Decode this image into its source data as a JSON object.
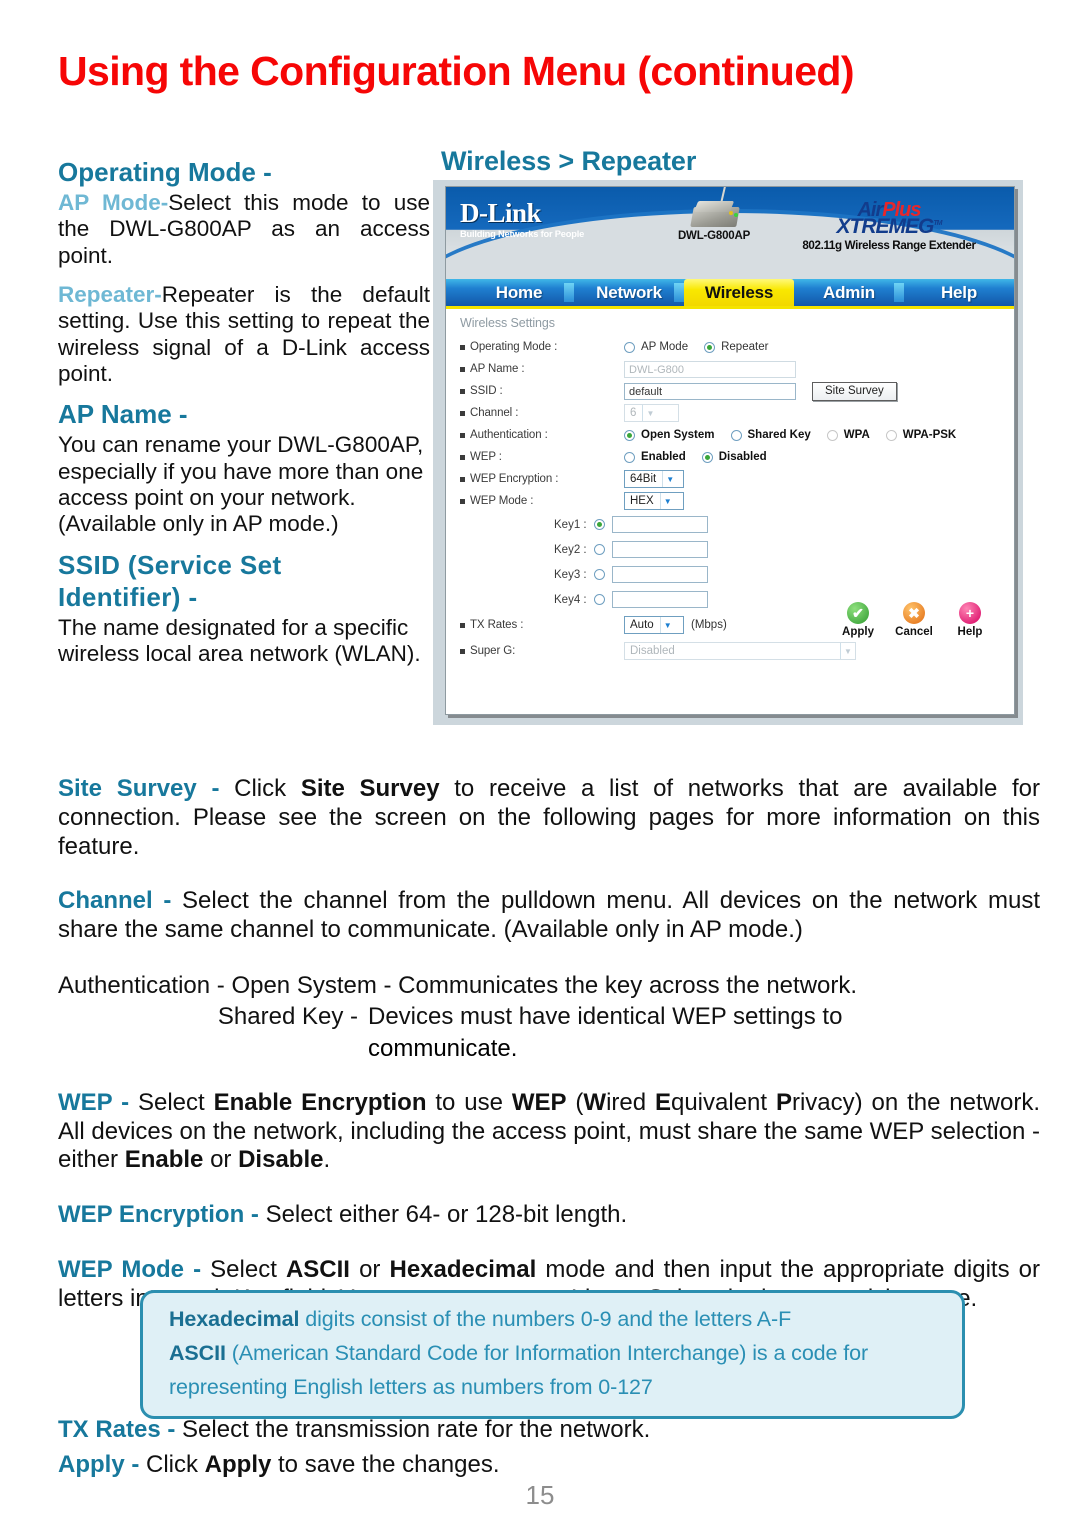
{
  "page": {
    "title": "Using the Configuration Menu (continued)",
    "number": "15",
    "accent_red": "#f60606",
    "accent_blue": "#17789c",
    "accent_light_blue": "#6fb8d4"
  },
  "left_column": {
    "operating_mode": {
      "heading": "Operating Mode -",
      "ap_mode_label": "AP Mode-",
      "ap_mode_text": "Select this mode to use the DWL-G800AP as an access point.",
      "repeater_label": "Repeater-",
      "repeater_text": "Repeater is the default setting. Use this setting to repeat the wireless signal of a D-Link access point."
    },
    "ap_name": {
      "heading": "AP Name -",
      "text": "You can rename your DWL-G800AP, especially if you have more than one access point on your network. (Available only in AP mode.)"
    },
    "ssid": {
      "heading_line1": "SSID (Service Set",
      "heading_line2": "Identifier) -",
      "text": "The name designated for a specific wireless local area network (WLAN)."
    }
  },
  "screenshot": {
    "caption": "Wireless > Repeater",
    "brand": {
      "name": "D-Link",
      "tagline": "Building Networks for People",
      "device_model": "DWL-G800AP",
      "product_air": "Air",
      "product_plus": "Plus",
      "product_xtreme": "XTREME",
      "product_g": "G",
      "product_tm": "TM",
      "product_subtitle": "802.11g Wireless Range Extender"
    },
    "tabs": [
      {
        "label": "Home",
        "active": false
      },
      {
        "label": "Network",
        "active": false
      },
      {
        "label": "Wireless",
        "active": true
      },
      {
        "label": "Admin",
        "active": false
      },
      {
        "label": "Help",
        "active": false
      }
    ],
    "section_title": "Wireless Settings",
    "fields": {
      "operating_mode_label": "Operating Mode :",
      "operating_mode_opt1": "AP Mode",
      "operating_mode_opt2": "Repeater",
      "operating_mode_selected": "Repeater",
      "ap_name_label": "AP Name :",
      "ap_name_value": "DWL-G800",
      "ssid_label": "SSID :",
      "ssid_value": "default",
      "site_survey_button": "Site Survey",
      "channel_label": "Channel :",
      "channel_value": "6",
      "authentication_label": "Authentication :",
      "auth_opt1": "Open System",
      "auth_opt2": "Shared Key",
      "auth_opt3": "WPA",
      "auth_opt4": "WPA-PSK",
      "auth_selected": "Open System",
      "wep_label": "WEP :",
      "wep_opt1": "Enabled",
      "wep_opt2": "Disabled",
      "wep_selected": "Disabled",
      "wep_encryption_label": "WEP Encryption :",
      "wep_encryption_value": "64Bit",
      "wep_mode_label": "WEP Mode :",
      "wep_mode_value": "HEX",
      "keys": [
        {
          "label": "Key1 :",
          "value": "",
          "selected": true
        },
        {
          "label": "Key2 :",
          "value": "",
          "selected": false
        },
        {
          "label": "Key3 :",
          "value": "",
          "selected": false
        },
        {
          "label": "Key4 :",
          "value": "",
          "selected": false
        }
      ],
      "tx_rates_label": "TX Rates :",
      "tx_rates_value": "Auto",
      "tx_rates_unit": "(Mbps)",
      "super_g_label": "Super G:",
      "super_g_value": "Disabled"
    },
    "actions": [
      {
        "name": "Apply",
        "glyph": "✔"
      },
      {
        "name": "Cancel",
        "glyph": "✖"
      },
      {
        "name": "Help",
        "glyph": "+"
      }
    ]
  },
  "body": {
    "site_survey": {
      "head": "Site Survey - ",
      "t1": "Click ",
      "b1": "Site Survey",
      "t2": " to receive a list of networks that are available for connection. Please see the screen on the following pages for more information on this feature."
    },
    "channel": {
      "head": "Channel - ",
      "t1": "Select the channel from the pulldown menu. All devices on the network must share the same channel to communicate. (Available only in AP mode.)"
    },
    "authentication": {
      "head": "Authentication - ",
      "open_system": "Open System",
      "open_system_text": " - Communicates the key across the network.",
      "shared_key": "Shared Key",
      "shared_key_dash": " - ",
      "shared_key_text": "Devices must have identical WEP settings to",
      "shared_key_text2": "communicate."
    },
    "wep": {
      "head": "WEP - ",
      "t1": "Select ",
      "b1": "Enable Encryption",
      "t2": " to use ",
      "b2": "WEP",
      "t3": " (",
      "b3": "W",
      "t4": "ired ",
      "b4": "E",
      "t5": "quivalent ",
      "b5": "P",
      "t6": "rivacy) on the network. All devices on the network, including the access point, must share the same WEP selection - either ",
      "b6": "Enable",
      "t7": " or ",
      "b7": "Disable",
      "t8": "."
    },
    "wep_encryption": {
      "head": "WEP Encryption - ",
      "t1": "Select either 64- or 128-bit length."
    },
    "wep_mode": {
      "head": "WEP Mode - ",
      "t1": "Select ",
      "b1": "ASCII",
      "t2": " or ",
      "b2": "Hexadecimal",
      "t3": " mode and then input the appropriate digits or letters into each Key field. You can create up to 4 keys. Select the key you wish to use."
    },
    "tx_rates": {
      "head": "TX Rates - ",
      "t1": "Select the transmission rate for the network."
    },
    "apply": {
      "head": "Apply - ",
      "t1": "Click ",
      "b1": "Apply",
      "t2": " to save the changes."
    }
  },
  "callout": {
    "line1_bold": "Hexadecimal",
    "line1_text": " digits consist of the numbers 0-9 and the letters A-F",
    "line2_bold": "ASCII",
    "line2_text": " (American Standard Code for Information Interchange) is a code for",
    "line3_text": "representing English letters as numbers from 0-127"
  }
}
